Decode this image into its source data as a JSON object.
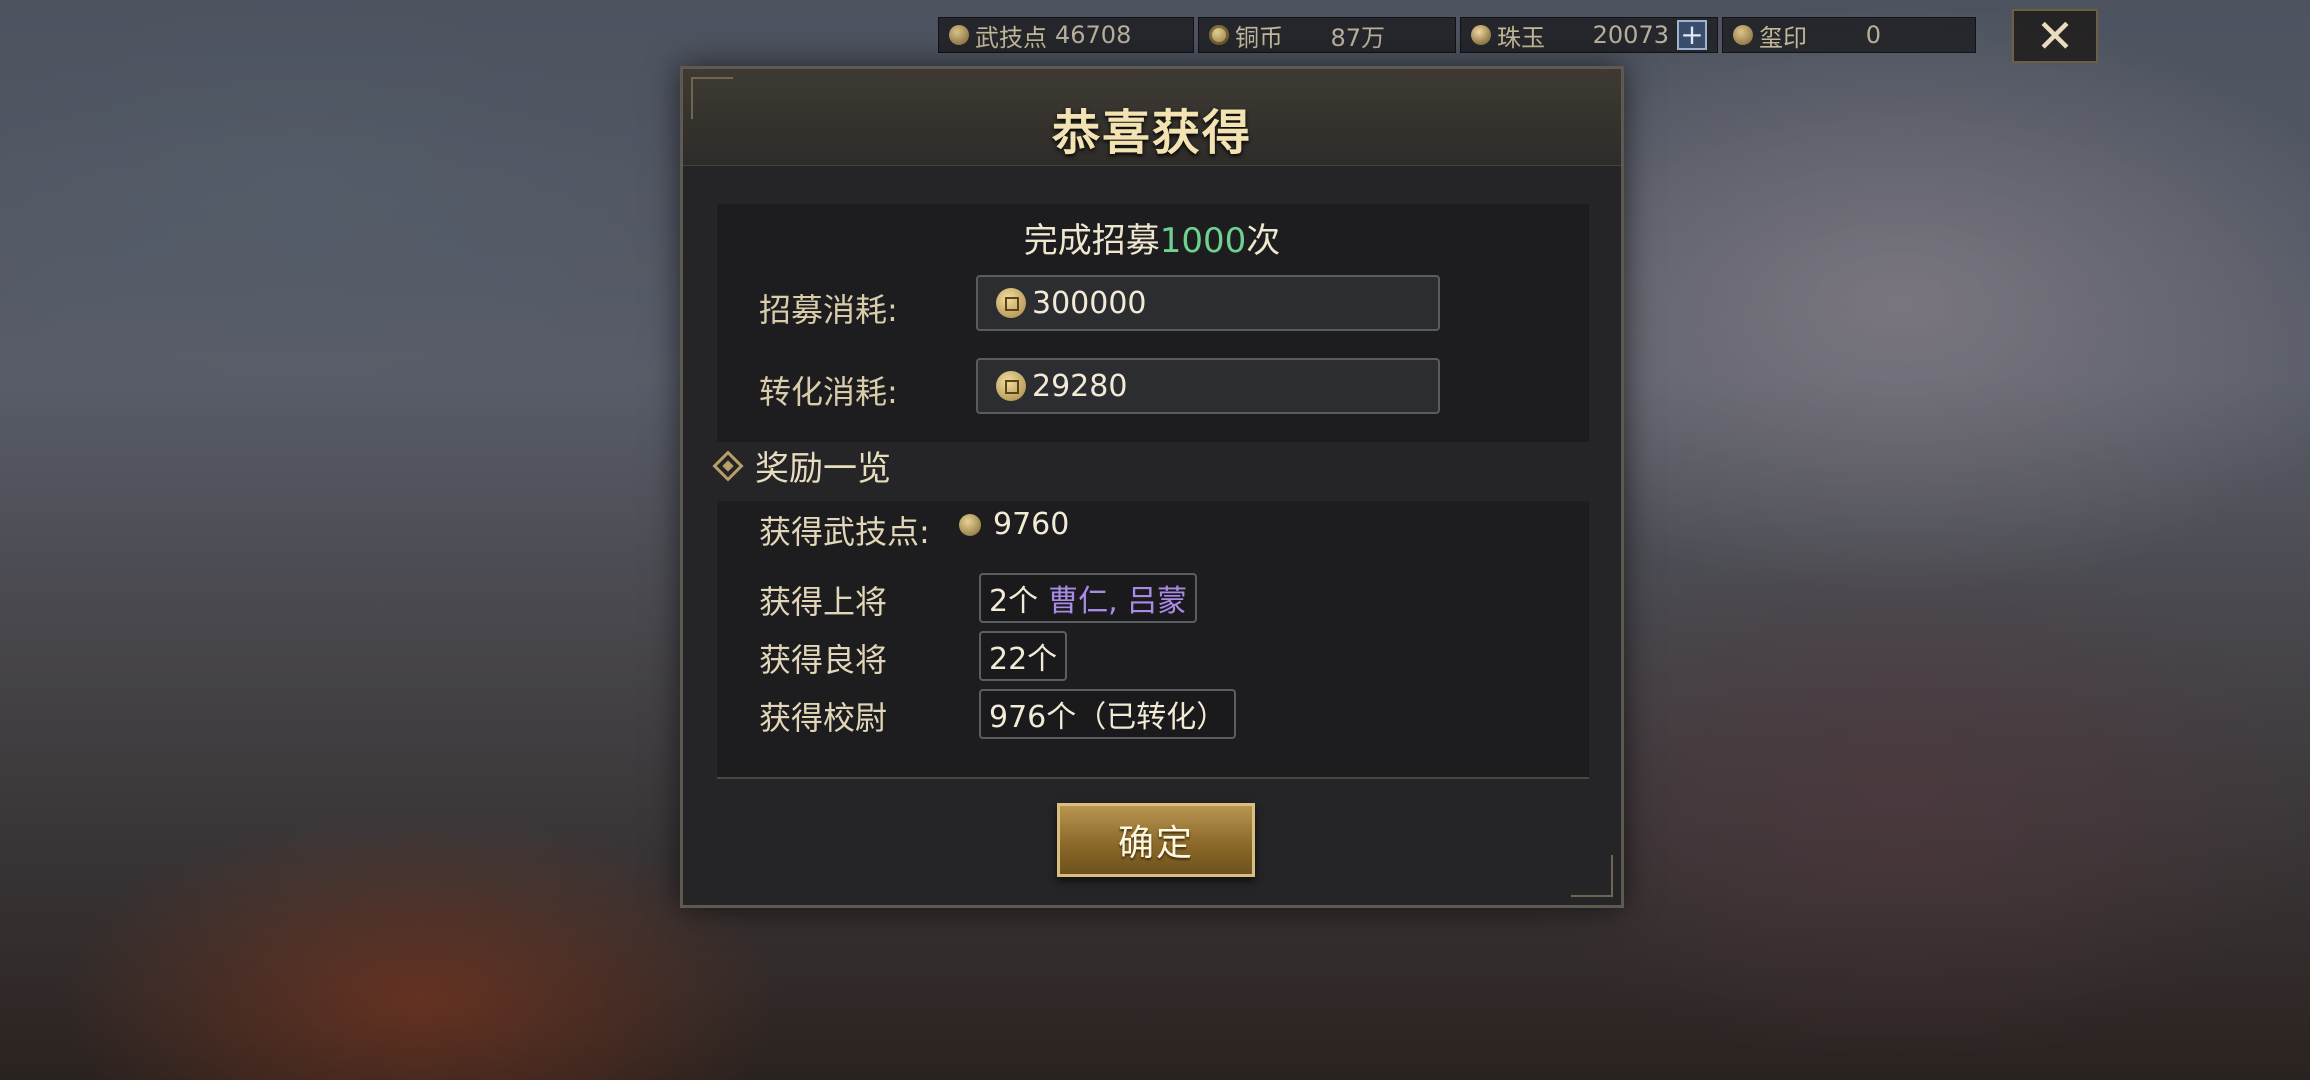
{
  "currencies": [
    {
      "icon": "martial-points-icon",
      "label": "武技点",
      "value": "46708"
    },
    {
      "icon": "copper-coin-icon",
      "label": "铜币",
      "value": "87万"
    },
    {
      "icon": "jade-icon",
      "label": "珠玉",
      "value": "20073"
    },
    {
      "icon": "seal-icon",
      "label": "玺印",
      "value": "0"
    }
  ],
  "dialog": {
    "title": "恭喜获得",
    "summary_prefix": "完成招募",
    "summary_count": "1000",
    "summary_suffix": "次",
    "recruit_cost_label": "招募消耗:",
    "recruit_cost_value": "300000",
    "convert_cost_label": "转化消耗:",
    "convert_cost_value": "29280",
    "rewards_title": "奖励一览",
    "martial_points_label": "获得武技点:",
    "martial_points_value": "9760",
    "top_generals_label": "获得上将",
    "top_generals_count": "2个",
    "top_generals_names": "曹仁, 吕蒙",
    "good_generals_label": "获得良将",
    "good_generals_value": "22个",
    "officers_label": "获得校尉",
    "officers_value": "976个（已转化）",
    "confirm_label": "确定"
  },
  "colors": {
    "count_highlight": "#6fd08f",
    "general_names": "#a98be6",
    "title_gold": "#f3e3b2"
  }
}
